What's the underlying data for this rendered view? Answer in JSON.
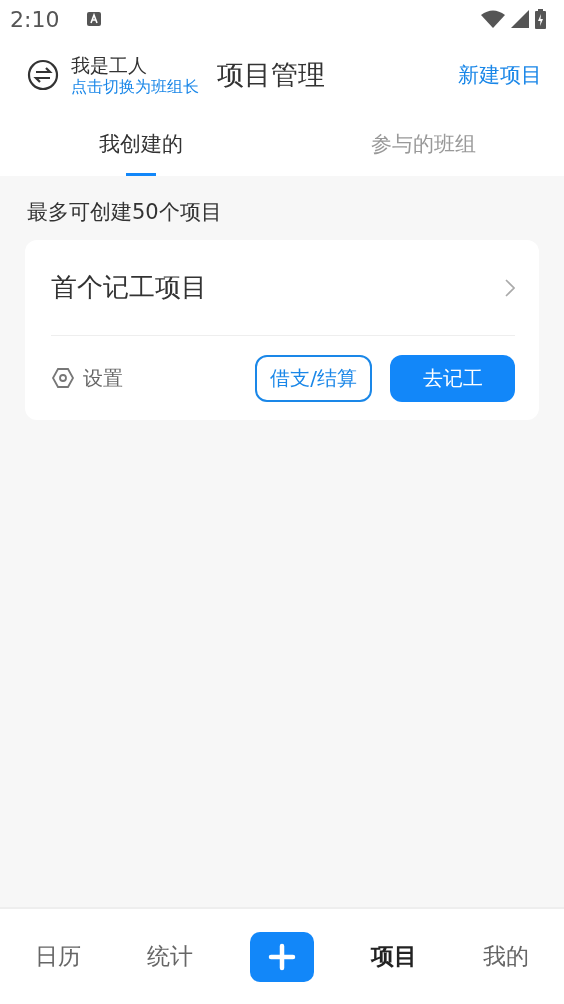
{
  "status_bar": {
    "time": "2:10"
  },
  "header": {
    "role": "我是工人",
    "switch_link": "点击切换为班组长",
    "title": "项目管理",
    "action": "新建项目"
  },
  "tabs": [
    {
      "label": "我创建的",
      "selected": true
    },
    {
      "label": "参与的班组",
      "selected": false
    }
  ],
  "note": "最多可创建50个项目",
  "projects": [
    {
      "name": "首个记工项目",
      "settings": "设置",
      "secondary_button": "借支/结算",
      "primary_button": "去记工"
    }
  ],
  "bottom_nav": [
    {
      "kind": "text",
      "label": "日历",
      "selected": false
    },
    {
      "kind": "text",
      "label": "统计",
      "selected": false
    },
    {
      "kind": "add"
    },
    {
      "kind": "text",
      "label": "项目",
      "selected": true
    },
    {
      "kind": "text",
      "label": "我的",
      "selected": false
    }
  ]
}
